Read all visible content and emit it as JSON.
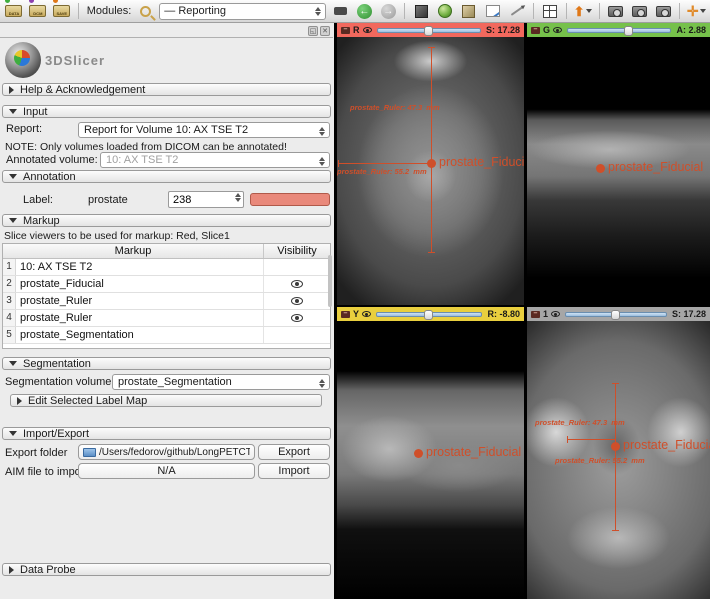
{
  "toolbar": {
    "modules_label": "Modules:",
    "module_selected": "— Reporting",
    "file_icons": [
      "DATA",
      "DCM",
      "SAVE"
    ],
    "icon_names": [
      "load-data-icon",
      "load-dicom-icon",
      "save-icon",
      "search-icon",
      "module-history-icon",
      "back-icon",
      "forward-icon",
      "modules-cube-icon",
      "data-sphere-icon",
      "volumes-cube-icon",
      "chart-icon",
      "annotate-pen-icon",
      "layout-grid-icon",
      "screenshot-capture-icon",
      "screen-capture-icon",
      "scene-view-icon",
      "scene-view-restore-icon",
      "crosshair-icon"
    ]
  },
  "panel": {
    "logo_text": "3DSlicer",
    "sections": {
      "help": "Help & Acknowledgement",
      "input": "Input",
      "annotation": "Annotation",
      "markup": "Markup",
      "segmentation": "Segmentation",
      "import_export": "Import/Export",
      "data_probe": "Data Probe"
    },
    "input": {
      "report_label": "Report:",
      "report_value": "Report for Volume 10: AX TSE T2",
      "note": "NOTE: Only volumes loaded from DICOM can be annotated!",
      "annotated_volume_label": "Annotated volume:",
      "annotated_volume_value": "10: AX TSE T2"
    },
    "annotation": {
      "label_label": "Label:",
      "label_value": "prostate",
      "label_number": "238",
      "color_swatch": "#e9897b"
    },
    "markup": {
      "slice_viewers_note": "Slice viewers to be used for markup: Red, Slice1",
      "columns": {
        "markup": "Markup",
        "visibility": "Visibility"
      },
      "rows": [
        {
          "num": "1",
          "name": "10: AX TSE T2",
          "visible": false
        },
        {
          "num": "2",
          "name": "prostate_Fiducial",
          "visible": true
        },
        {
          "num": "3",
          "name": "prostate_Ruler",
          "visible": true
        },
        {
          "num": "4",
          "name": "prostate_Ruler",
          "visible": true
        },
        {
          "num": "5",
          "name": "prostate_Segmentation",
          "visible": false
        }
      ]
    },
    "segmentation": {
      "volume_label": "Segmentation volume:",
      "volume_value": "prostate_Segmentation",
      "edit_button": "Edit Selected Label Map"
    },
    "import_export": {
      "export_folder_label": "Export folder",
      "export_folder_value": "/Users/fedorov/github/LongPETCT-build",
      "export_button": "Export",
      "aim_label": "AIM file to import",
      "aim_value": "N/A",
      "import_button": "Import"
    }
  },
  "viewers": {
    "red": {
      "letter": "R",
      "readout": "S: 17.28",
      "color": "#f2685d",
      "slider_pct": 45
    },
    "green": {
      "letter": "G",
      "readout": "A: 2.88",
      "color": "#76c14b",
      "slider_pct": 55
    },
    "yellow": {
      "letter": "Y",
      "readout": "R: -8.80",
      "color": "#e9cf3e",
      "slider_pct": 45
    },
    "compare": {
      "letter": "1",
      "readout": "S: 17.28",
      "color": "#a6a6a6",
      "slider_pct": 45
    },
    "markup_color": "#cf4f2a",
    "labels": {
      "fiducial": "prostate_Fiducial",
      "ruler_a": "prostate_Ruler: 47.3  mm",
      "ruler_b": "prostate_Ruler: 55.2  mm"
    }
  }
}
